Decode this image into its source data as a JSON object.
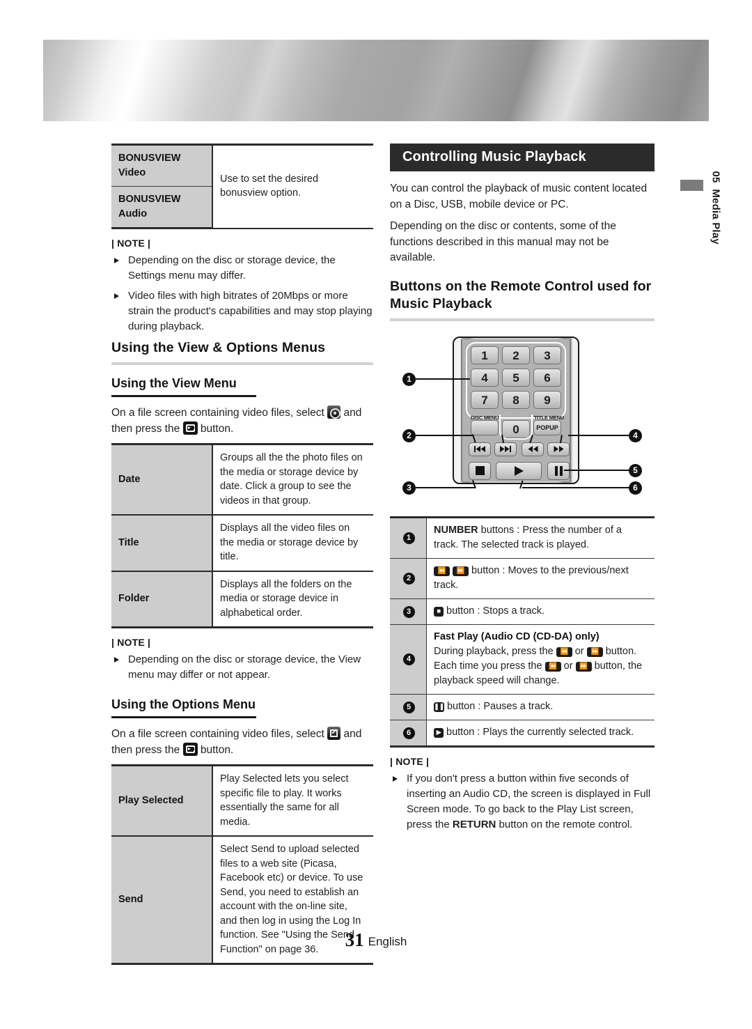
{
  "banner": {
    "name": "metallic-header-band"
  },
  "side_tab": {
    "chapter_number": "05",
    "chapter_title": "Media Play"
  },
  "left_column": {
    "bonusview_table": {
      "rows": [
        {
          "key": "BONUSVIEW Video",
          "key_line1": "BONUSVIEW",
          "key_line2": "Video"
        },
        {
          "key": "BONUSVIEW Audio",
          "key_line1": "BONUSVIEW",
          "key_line2": "Audio"
        }
      ],
      "description": "Use to set the desired bonusview option."
    },
    "note1": {
      "label": "| NOTE |",
      "items": [
        "Depending on the disc or storage device, the Settings menu may differ.",
        "Video files with high bitrates of 20Mbps or more strain the product's capabilities and may stop playing during playback."
      ]
    },
    "heading_view_options": "Using the View & Options Menus",
    "heading_view_menu": "Using the View Menu",
    "view_menu_intro_a": "On a file screen containing video files, select",
    "view_menu_intro_b": "and then press the",
    "view_menu_intro_c": "button.",
    "view_table": {
      "rows": [
        {
          "key": "Date",
          "value": "Groups all the the photo files on the media or storage device by date. Click a group to see the videos in that group."
        },
        {
          "key": "Title",
          "value": "Displays all the video files on the media or storage device by title."
        },
        {
          "key": "Folder",
          "value": "Displays all the folders on the media or storage device in alphabetical order."
        }
      ]
    },
    "note2": {
      "label": "| NOTE |",
      "items": [
        "Depending on the disc or storage device, the View menu may differ or not appear."
      ]
    },
    "heading_options_menu": "Using the Options Menu",
    "options_menu_intro_a": "On a file screen containing video files, select",
    "options_menu_intro_b": "and then press the",
    "options_menu_intro_c": "button.",
    "options_table": {
      "rows": [
        {
          "key": "Play Selected",
          "value": "Play Selected lets you select specific file to play. It works essentially the same for all media."
        },
        {
          "key": "Send",
          "value": "Select Send to upload selected files to a web site (Picasa, Facebook etc) or device. To use Send, you need to establish an account with the on-line site, and then log in using the Log In function. See \"Using the Send Function\" on page 36."
        }
      ]
    }
  },
  "right_column": {
    "section_title": "Controlling Music Playback",
    "intro_p1": "You can control the playback of music content located on a Disc, USB, mobile device or PC.",
    "intro_p2": "Depending on the disc or contents, some of the functions described in this manual may not be available.",
    "heading_buttons": "Buttons on the Remote Control used for Music Playback",
    "remote": {
      "number_keys": [
        "1",
        "2",
        "3",
        "4",
        "5",
        "6",
        "7",
        "8",
        "9",
        "0"
      ],
      "disc_menu_label": "DISC MENU",
      "title_menu_label": "TITLE MENU",
      "popup_label": "POPUP",
      "callouts": [
        "1",
        "2",
        "3",
        "4",
        "5",
        "6"
      ],
      "transport_glyphs": {
        "prev": "⏮",
        "next": "⏭",
        "rew": "◀◀",
        "ff": "▶▶",
        "stop": "■",
        "play": "▶",
        "pause": "Ⅱ"
      }
    },
    "legend_table": {
      "rows": [
        {
          "num": "1",
          "bold_lead": "NUMBER",
          "text": " buttons : Press the number of a track. The selected track is played."
        },
        {
          "num": "2",
          "text": " button : Moves to the previous/next track."
        },
        {
          "num": "3",
          "text": " button : Stops a track."
        },
        {
          "num": "4",
          "subtitle": "Fast Play (Audio CD (CD-DA) only)",
          "line1a": "During playback, press the",
          "line1b": "or",
          "line1c": "button.",
          "line2a": "Each time you press the",
          "line2b": "or",
          "line2c": "button, the playback speed will change."
        },
        {
          "num": "5",
          "text": " button : Pauses a track."
        },
        {
          "num": "6",
          "text": " button : Plays the currently selected track."
        }
      ]
    },
    "note3": {
      "label": "| NOTE |",
      "item_a": "If you don't press a button within five seconds of inserting an Audio CD, the screen is displayed in Full Screen mode. To go back to the Play List screen, press the",
      "item_bold": "RETURN",
      "item_b": "button on the remote control."
    }
  },
  "footer": {
    "page_number": "31",
    "language": "English"
  },
  "colors": {
    "header_bar": "#2b2b2b",
    "table_key_bg": "#cdcdcd",
    "rule": "#d2d2d2"
  }
}
